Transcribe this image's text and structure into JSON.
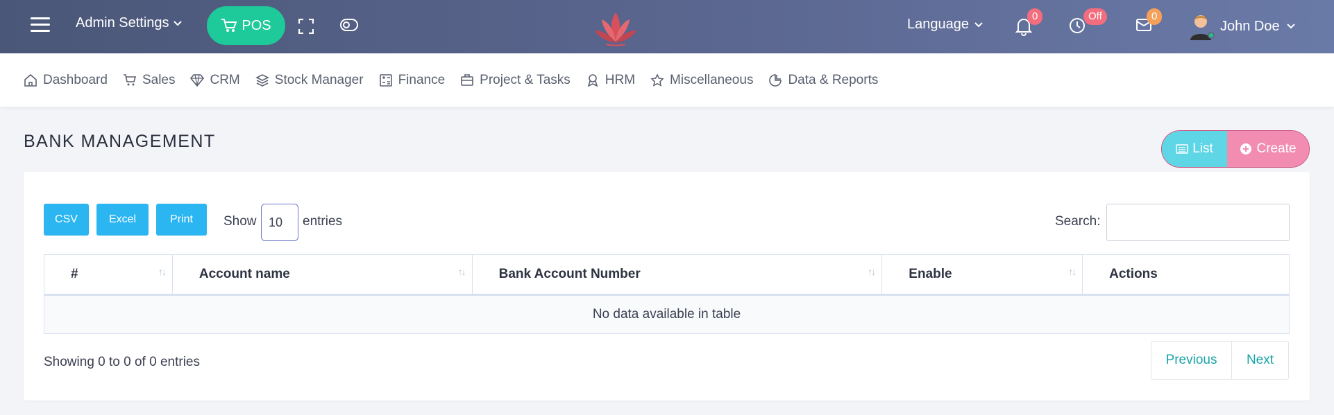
{
  "topbar": {
    "admin_settings": "Admin Settings",
    "pos_label": "POS",
    "language": "Language",
    "notifications_count": "0",
    "clock_status": "Off",
    "messages_count": "0",
    "user_name": "John Doe"
  },
  "menu": {
    "items": [
      {
        "label": "Dashboard",
        "icon": "home-icon"
      },
      {
        "label": "Sales",
        "icon": "cart-icon"
      },
      {
        "label": "CRM",
        "icon": "diamond-icon"
      },
      {
        "label": "Stock Manager",
        "icon": "layers-icon"
      },
      {
        "label": "Finance",
        "icon": "calculator-icon"
      },
      {
        "label": "Project & Tasks",
        "icon": "briefcase-icon"
      },
      {
        "label": "HRM",
        "icon": "award-icon"
      },
      {
        "label": "Miscellaneous",
        "icon": "star-icon"
      },
      {
        "label": "Data & Reports",
        "icon": "pie-chart-icon"
      }
    ]
  },
  "page": {
    "title": "BANK MANAGEMENT",
    "list_label": "List",
    "create_label": "Create"
  },
  "table_controls": {
    "csv": "CSV",
    "excel": "Excel",
    "print": "Print",
    "show_label": "Show",
    "page_length": "10",
    "entries_label": "entries",
    "search_label": "Search:",
    "search_value": ""
  },
  "table": {
    "columns": [
      "#",
      "Account name",
      "Bank Account Number",
      "Enable",
      "Actions"
    ],
    "empty_message": "No data available in table"
  },
  "footer": {
    "info": "Showing 0 to 0 of 0 entries",
    "previous": "Previous",
    "next": "Next"
  },
  "colors": {
    "pos": "#1ec99a",
    "list": "#5fd6e6",
    "create": "#f28cb0",
    "export": "#2bb6f2",
    "badge_red": "#f26d7d",
    "badge_orange": "#f5a05a",
    "pager_text": "#1aa3a8"
  }
}
